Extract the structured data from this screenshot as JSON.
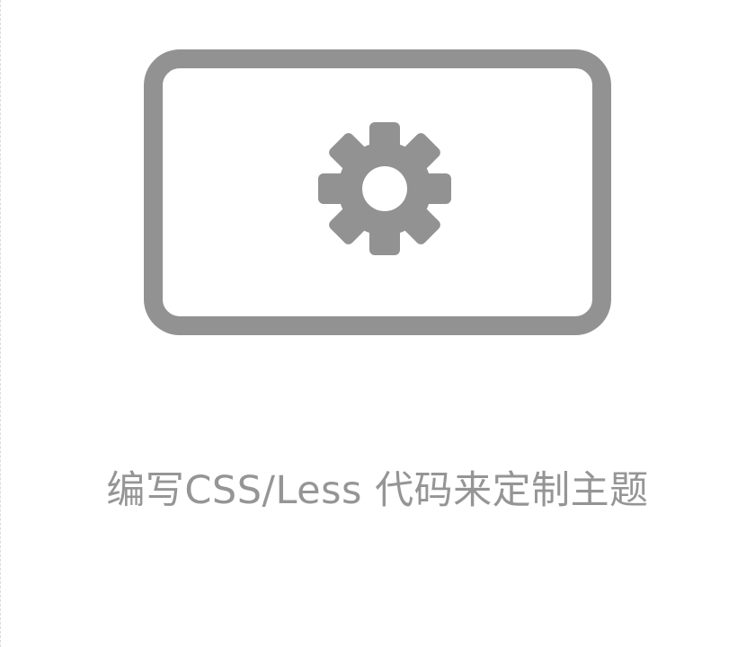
{
  "card": {
    "icon": "gear-icon",
    "caption": "编写CSS/Less 代码来定制主题"
  },
  "colors": {
    "icon": "#929292",
    "text": "#959595",
    "background": "#ffffff"
  }
}
